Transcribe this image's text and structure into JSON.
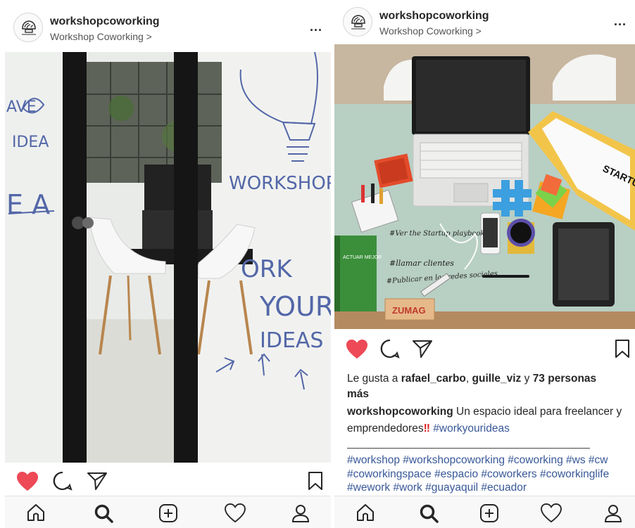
{
  "posts": [
    {
      "username": "workshopcoworking",
      "location": "Workshop Coworking >",
      "more": "...",
      "image_alt_words": [
        "AVE",
        "IDEA",
        "E A",
        "WORKSHOP",
        "ORK",
        "YOUR",
        "IDEAS"
      ]
    },
    {
      "username": "workshopcoworking",
      "location": "Workshop Coworking >",
      "more": "...",
      "image_words": {
        "book": "STARTUP",
        "sign": "ZUMAG",
        "note1": "#Ver the Startup playbook",
        "note2": "#llamar clientes",
        "note3": "#Publicar en las redes sociales",
        "green_book": "ACTUAR MEJOR"
      },
      "likes": {
        "prefix": "Le gusta a ",
        "user1": "rafael_carbo",
        "sep": ", ",
        "user2": "guille_viz",
        "middle": " y ",
        "count": "73 personas",
        "suffix": "más"
      },
      "caption": {
        "username": "workshopcoworking",
        "text": " Un espacio ideal para freelancer y emprendedores",
        "emoji": "‼",
        "tag": "#workyourideas"
      },
      "hashtags": "#workshop #workshopcoworking #coworking #ws #cw #coworkingspace #espacio #coworkers #coworkinglife #wework #work #guayaquil #ecuador"
    }
  ],
  "colors": {
    "like_red": "#ed4956",
    "link_blue": "#385898",
    "text": "#262626"
  },
  "icons": [
    "home-icon",
    "search-icon",
    "add-icon",
    "heart-icon",
    "profile-icon",
    "comment-icon",
    "share-icon",
    "bookmark-icon"
  ]
}
